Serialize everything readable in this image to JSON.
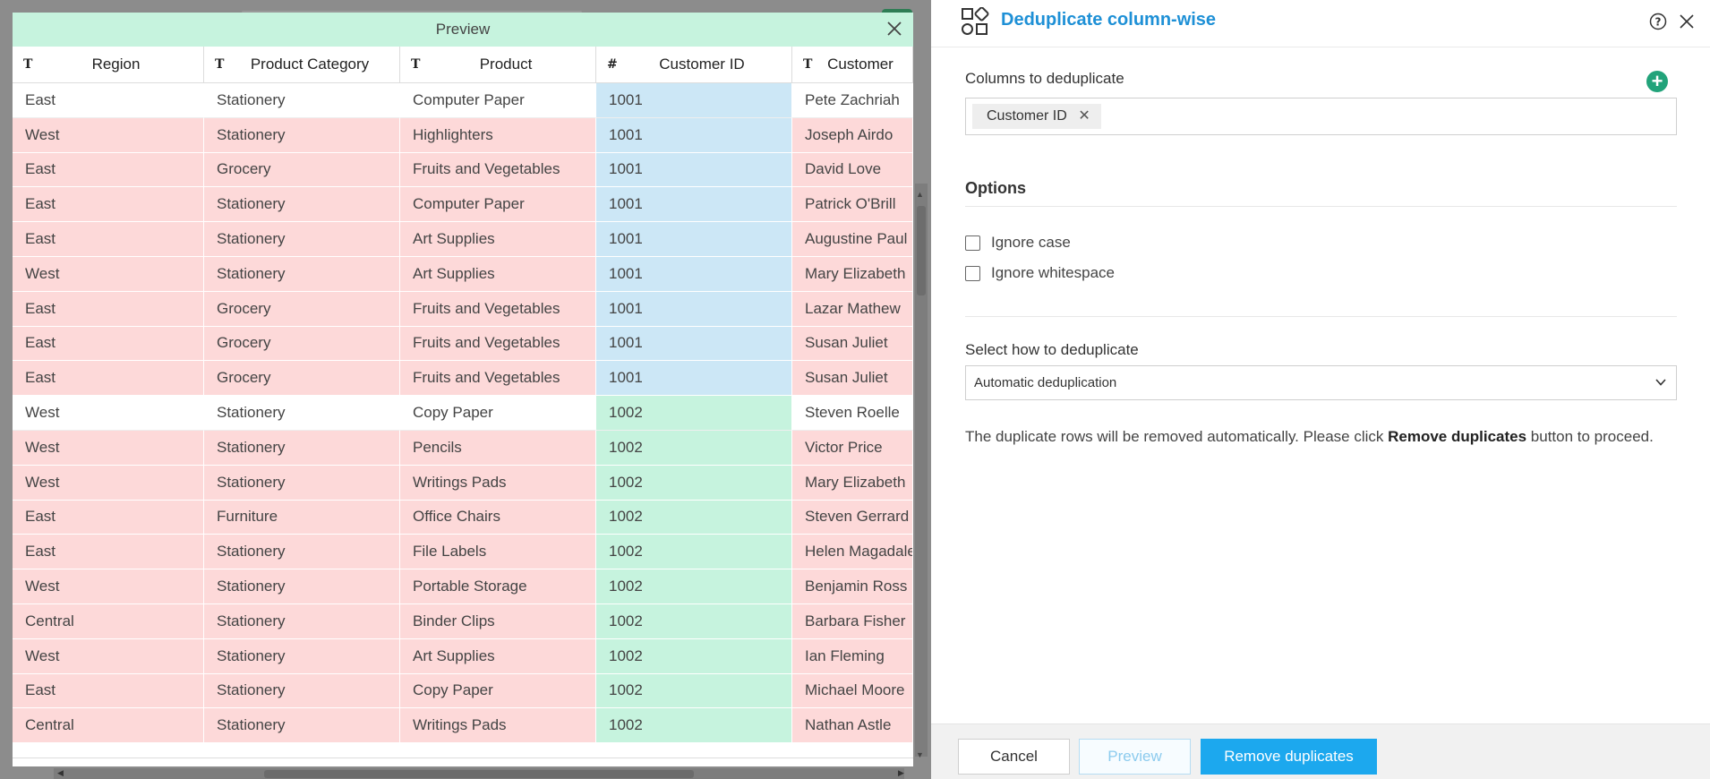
{
  "preview": {
    "title": "Preview",
    "columns": [
      {
        "type_icon": "T",
        "label": "Region"
      },
      {
        "type_icon": "T",
        "label": "Product Category"
      },
      {
        "type_icon": "T",
        "label": "Product"
      },
      {
        "type_icon": "#",
        "label": "Customer ID"
      },
      {
        "type_icon": "T",
        "label": "Customer"
      }
    ],
    "rows": [
      {
        "status": "keep",
        "cells": [
          "East",
          "Stationery",
          "Computer Paper",
          "1001",
          "Pete Zachriah"
        ]
      },
      {
        "status": "dup",
        "cells": [
          "West",
          "Stationery",
          "Highlighters",
          "1001",
          "Joseph Airdo"
        ]
      },
      {
        "status": "dup",
        "cells": [
          "East",
          "Grocery",
          "Fruits and Vegetables",
          "1001",
          "David Love"
        ]
      },
      {
        "status": "dup",
        "cells": [
          "East",
          "Stationery",
          "Computer Paper",
          "1001",
          "Patrick O'Brill"
        ]
      },
      {
        "status": "dup",
        "cells": [
          "East",
          "Stationery",
          "Art Supplies",
          "1001",
          "Augustine Paul"
        ]
      },
      {
        "status": "dup",
        "cells": [
          "West",
          "Stationery",
          "Art Supplies",
          "1001",
          "Mary Elizabeth"
        ]
      },
      {
        "status": "dup",
        "cells": [
          "East",
          "Grocery",
          "Fruits and Vegetables",
          "1001",
          "Lazar Mathew"
        ]
      },
      {
        "status": "dup",
        "cells": [
          "East",
          "Grocery",
          "Fruits and Vegetables",
          "1001",
          "Susan Juliet"
        ]
      },
      {
        "status": "dup",
        "cells": [
          "East",
          "Grocery",
          "Fruits and Vegetables",
          "1001",
          "Susan Juliet"
        ]
      },
      {
        "status": "keep",
        "cells": [
          "West",
          "Stationery",
          "Copy Paper",
          "1002",
          "Steven Roelle"
        ]
      },
      {
        "status": "dup",
        "cells": [
          "West",
          "Stationery",
          "Pencils",
          "1002",
          "Victor Price"
        ]
      },
      {
        "status": "dup",
        "cells": [
          "West",
          "Stationery",
          "Writings Pads",
          "1002",
          "Mary Elizabeth"
        ]
      },
      {
        "status": "dup",
        "cells": [
          "East",
          "Furniture",
          "Office Chairs",
          "1002",
          "Steven Gerrard"
        ]
      },
      {
        "status": "dup",
        "cells": [
          "East",
          "Stationery",
          "File Labels",
          "1002",
          "Helen Magadale"
        ]
      },
      {
        "status": "dup",
        "cells": [
          "West",
          "Stationery",
          "Portable Storage",
          "1002",
          "Benjamin Ross"
        ]
      },
      {
        "status": "dup",
        "cells": [
          "Central",
          "Stationery",
          "Binder Clips",
          "1002",
          "Barbara Fisher"
        ]
      },
      {
        "status": "dup",
        "cells": [
          "West",
          "Stationery",
          "Art Supplies",
          "1002",
          "Ian Fleming"
        ]
      },
      {
        "status": "dup",
        "cells": [
          "East",
          "Stationery",
          "Copy Paper",
          "1002",
          "Michael Moore"
        ]
      },
      {
        "status": "dup",
        "cells": [
          "Central",
          "Stationery",
          "Writings Pads",
          "1002",
          "Nathan Astle"
        ]
      }
    ]
  },
  "panel": {
    "title": "Deduplicate column-wise",
    "columns_label": "Columns to deduplicate",
    "selected_column": "Customer ID",
    "options_title": "Options",
    "ignore_case_label": "Ignore case",
    "ignore_whitespace_label": "Ignore whitespace",
    "select_label": "Select how to deduplicate",
    "select_value": "Automatic deduplication",
    "info_prefix": "The duplicate rows will be removed automatically. Please click ",
    "info_bold": "Remove duplicates",
    "info_suffix": " button to proceed.",
    "cancel_label": "Cancel",
    "preview_label": "Preview",
    "remove_label": "Remove duplicates"
  },
  "colors": {
    "accent": "#1ca8ee",
    "title_blue": "#1e90d6",
    "duplicate_row": "#fdd9d9",
    "group_a": "#cce7f6",
    "group_b": "#c6f3de",
    "add_green": "#22a37a"
  },
  "icons": {
    "preview_close": "close-icon",
    "panel_icon": "deduplicate-shapes-icon",
    "help": "help-circle-icon",
    "panel_close": "close-icon",
    "add_column": "plus-circle-icon",
    "chip_remove": "close-icon",
    "select_chevron": "chevron-down-icon"
  }
}
